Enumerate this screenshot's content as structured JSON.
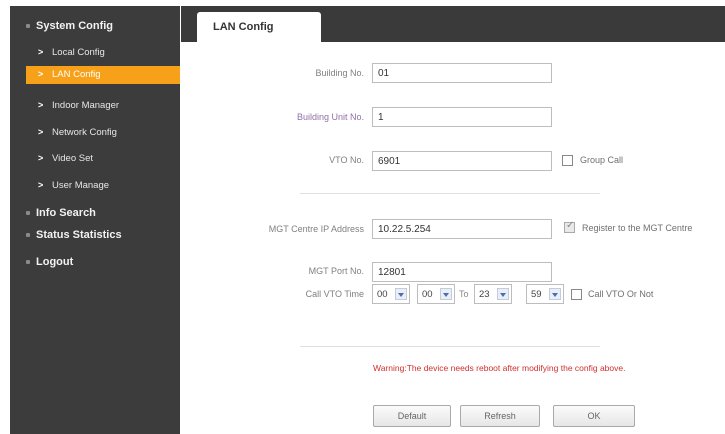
{
  "sidebar": {
    "system_config": "System Config",
    "local_config": "Local Config",
    "lan_config": "LAN Config",
    "indoor_manager": "Indoor Manager",
    "network_config": "Network Config",
    "video_set": "Video Set",
    "user_manage": "User Manage",
    "info_search": "Info Search",
    "status_statistics": "Status Statistics",
    "logout": "Logout"
  },
  "tab": {
    "title": "LAN Config"
  },
  "form": {
    "building_no_label": "Building No.",
    "building_no": "01",
    "building_unit_no_label": "Building Unit No.",
    "building_unit_no": "1",
    "vto_no_label": "VTO No.",
    "vto_no": "6901",
    "group_call_label": "Group Call",
    "mgt_ip_label": "MGT Centre IP Address",
    "mgt_ip": "10.22.5.254",
    "register_label": "Register to the MGT Centre",
    "mgt_port_label": "MGT Port No.",
    "mgt_port": "12801",
    "call_time_label": "Call VTO Time",
    "from_hour": "00",
    "from_min": "00",
    "to_label": "To",
    "to_hour": "23",
    "to_min": "59",
    "call_vto_or_not_label": "Call VTO Or Not",
    "warning": "Warning:The device needs reboot after modifying the config above."
  },
  "buttons": {
    "default": "Default",
    "refresh": "Refresh",
    "ok": "OK"
  },
  "colors": {
    "sidebar_bg": "#3c3c3c",
    "active_item": "#f7a11a",
    "warning_text": "#d03030"
  }
}
